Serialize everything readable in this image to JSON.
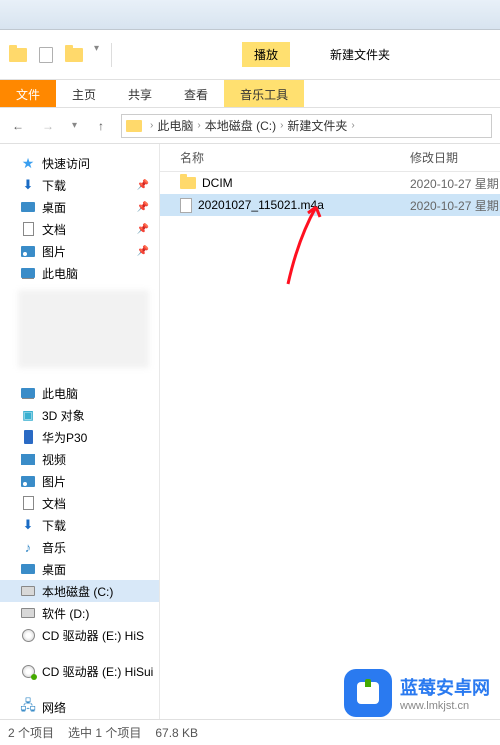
{
  "toolbar": {
    "play_label": "播放",
    "newfolder_label": "新建文件夹",
    "music_tool_label": "音乐工具"
  },
  "ribbon": {
    "file": "文件",
    "home": "主页",
    "share": "共享",
    "view": "查看",
    "music": "音乐工具"
  },
  "nav": {
    "back": "←",
    "forward": "→",
    "up": "↑"
  },
  "breadcrumb": {
    "sep": "›",
    "items": [
      "此电脑",
      "本地磁盘 (C:)",
      "新建文件夹"
    ]
  },
  "sidebar": {
    "quick": "快速访问",
    "downloads": "下载",
    "desktop": "桌面",
    "documents": "文档",
    "pictures": "图片",
    "thispc": "此电脑",
    "pc_section": "此电脑",
    "obj3d": "3D 对象",
    "huawei": "华为P30",
    "videos": "视频",
    "pictures2": "图片",
    "documents2": "文档",
    "downloads2": "下载",
    "music": "音乐",
    "desktop2": "桌面",
    "drive_c": "本地磁盘 (C:)",
    "drive_d": "软件 (D:)",
    "cd_e": "CD 驱动器 (E:) HiS",
    "cd_e2": "CD 驱动器 (E:) HiSui",
    "network": "网络"
  },
  "list": {
    "col_name": "名称",
    "col_date": "修改日期",
    "rows": [
      {
        "name": "DCIM",
        "date": "2020-10-27 星期",
        "type": "folder"
      },
      {
        "name": "20201027_115021.m4a",
        "date": "2020-10-27 星期",
        "type": "file"
      }
    ]
  },
  "status": {
    "count": "2 个项目",
    "selected": "选中 1 个项目",
    "size": "67.8 KB"
  },
  "watermark": {
    "title": "蓝莓安卓网",
    "url": "www.lmkjst.cn"
  }
}
